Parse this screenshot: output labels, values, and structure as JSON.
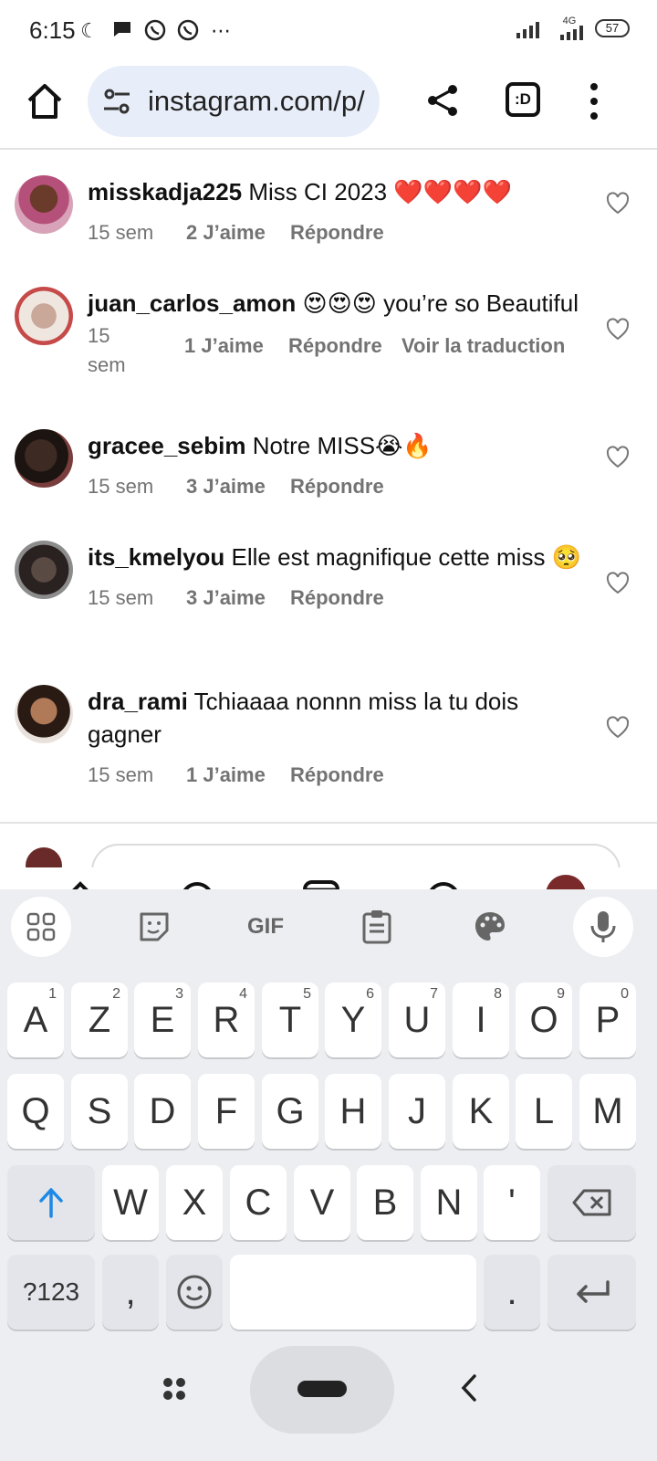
{
  "status_bar": {
    "time": "6:15",
    "network": "4G",
    "battery": "57"
  },
  "browser": {
    "url": "instagram.com/p/",
    "tab_label": ":D"
  },
  "comments": [
    {
      "username": "misskadja225",
      "text": "Miss CI 2023 ❤️❤️❤️❤️",
      "time": "15 sem",
      "likes": "2 J’aime",
      "reply": "Répondre",
      "translate": ""
    },
    {
      "username": "juan_carlos_amon",
      "text": "😍😍😍 you’re so Beautiful",
      "time": "15 sem",
      "likes": "1 J’aime",
      "reply": "Répondre",
      "translate": "Voir la traduction"
    },
    {
      "username": "gracee_sebim",
      "text": "Notre MISS😭🔥",
      "time": "15 sem",
      "likes": "3 J’aime",
      "reply": "Répondre",
      "translate": ""
    },
    {
      "username": "its_kmelyou",
      "text": "Elle est magnifique cette miss 🥺",
      "time": "15 sem",
      "likes": "3 J’aime",
      "reply": "Répondre",
      "translate": ""
    },
    {
      "username": "dra_rami",
      "text": "Tchiaaaa nonnn miss la tu dois gagner",
      "time": "15 sem",
      "likes": "1 J’aime",
      "reply": "Répondre",
      "translate": ""
    }
  ],
  "keyboard": {
    "toolbar": {
      "gif": "GIF"
    },
    "row1": [
      "A",
      "Z",
      "E",
      "R",
      "T",
      "Y",
      "U",
      "I",
      "O",
      "P"
    ],
    "row1_nums": [
      "1",
      "2",
      "3",
      "4",
      "5",
      "6",
      "7",
      "8",
      "9",
      "0"
    ],
    "row2": [
      "Q",
      "S",
      "D",
      "F",
      "G",
      "H",
      "J",
      "K",
      "L",
      "M"
    ],
    "row3": [
      "W",
      "X",
      "C",
      "V",
      "B",
      "N",
      "'"
    ],
    "row4": {
      "symbols": "?123",
      "comma": ",",
      "period": "."
    }
  }
}
